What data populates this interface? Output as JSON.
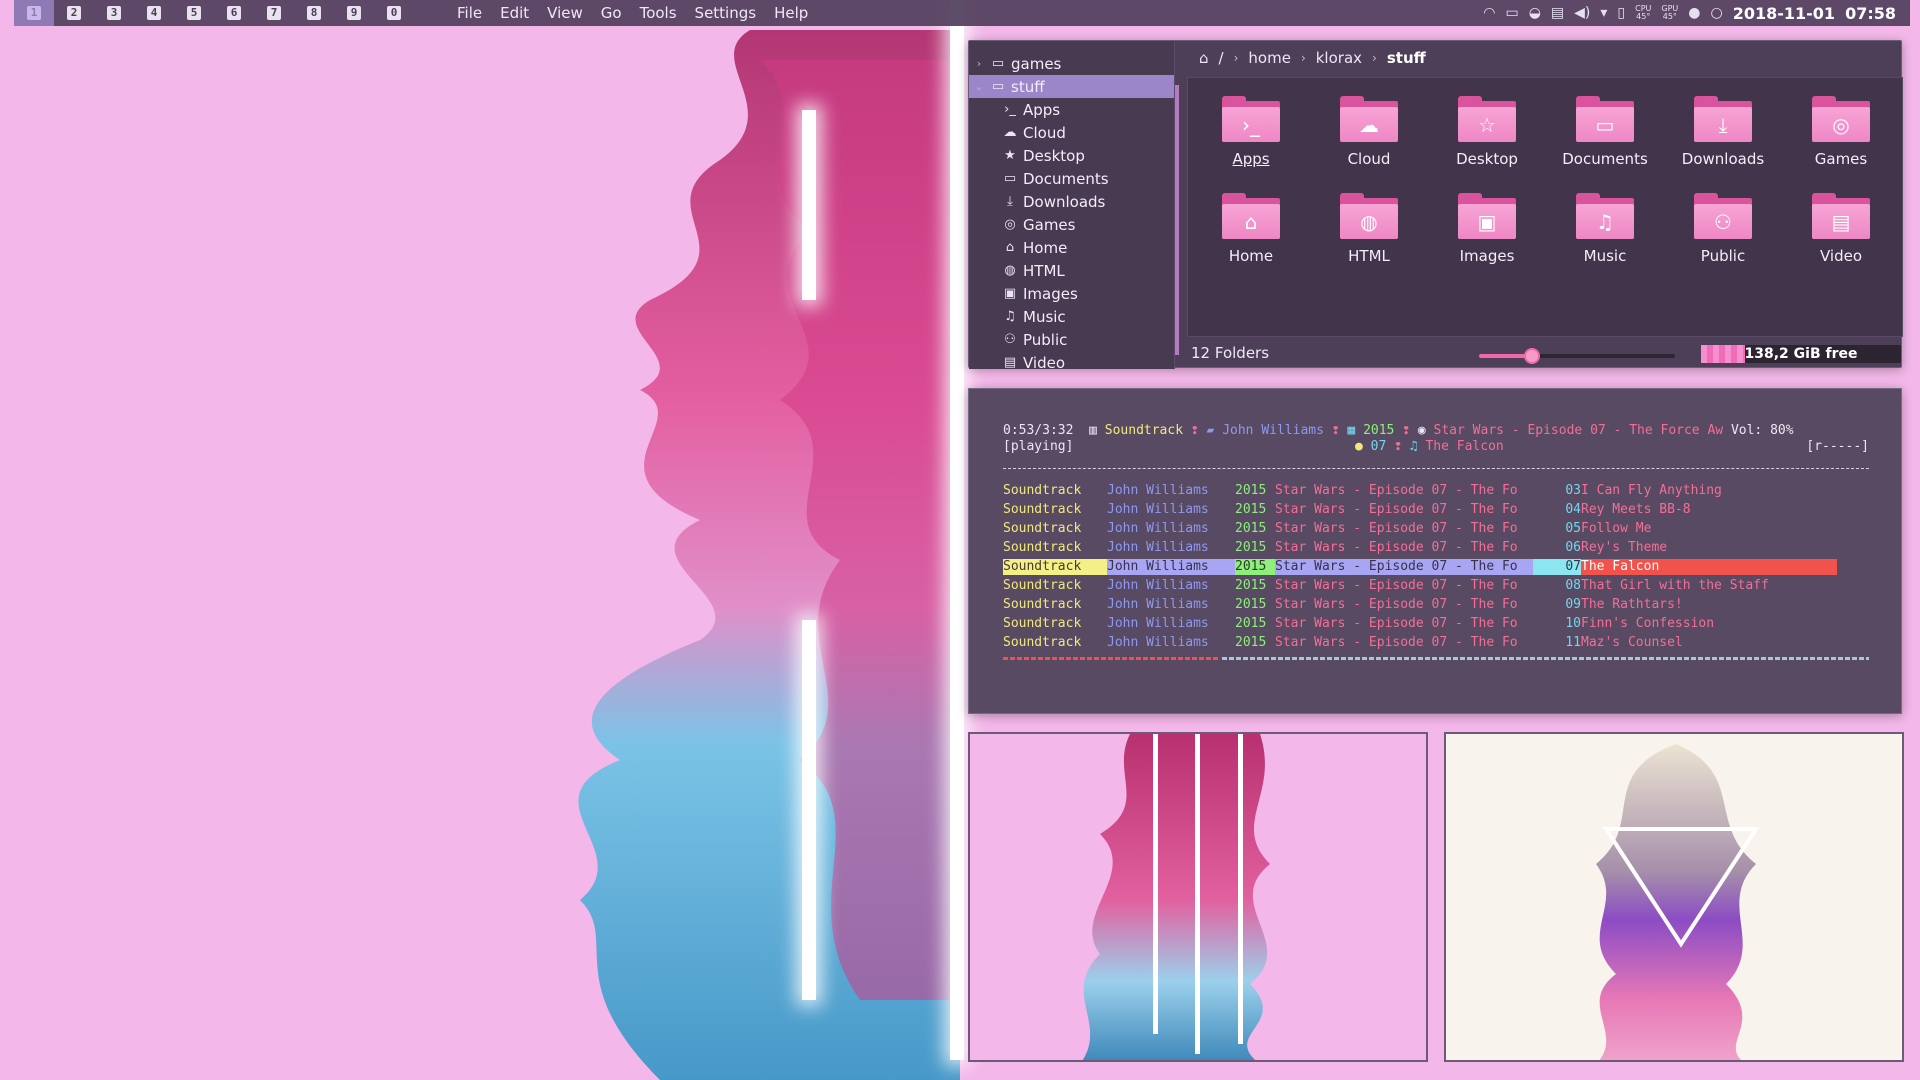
{
  "workspaces": [
    "1",
    "2",
    "3",
    "4",
    "5",
    "6",
    "7",
    "8",
    "9",
    "0"
  ],
  "menu": [
    "File",
    "Edit",
    "View",
    "Go",
    "Tools",
    "Settings",
    "Help"
  ],
  "tray": {
    "temp1_label": "CPU",
    "temp1": "45°",
    "temp2_label": "GPU",
    "temp2": "45°",
    "datetime": "2018-11-01",
    "time": "07:58"
  },
  "filemanager": {
    "tree": [
      {
        "label": "games",
        "icon": "folder-icon",
        "level": 0,
        "chevron": "›"
      },
      {
        "label": "stuff",
        "icon": "folder-icon",
        "level": 0,
        "chevron": "⌄",
        "selected": true
      },
      {
        "label": "Apps",
        "icon": "terminal-icon",
        "glyph": "›_",
        "level": 1
      },
      {
        "label": "Cloud",
        "icon": "cloud-icon",
        "glyph": "☁",
        "level": 1
      },
      {
        "label": "Desktop",
        "icon": "star-icon",
        "glyph": "★",
        "level": 1
      },
      {
        "label": "Documents",
        "icon": "document-icon",
        "glyph": "▭",
        "level": 1
      },
      {
        "label": "Downloads",
        "icon": "download-icon",
        "glyph": "⤓",
        "level": 1
      },
      {
        "label": "Games",
        "icon": "gamepad-icon",
        "glyph": "◎",
        "level": 1
      },
      {
        "label": "Home",
        "icon": "home-icon",
        "glyph": "⌂",
        "level": 1
      },
      {
        "label": "HTML",
        "icon": "globe-icon",
        "glyph": "◍",
        "level": 1
      },
      {
        "label": "Images",
        "icon": "image-icon",
        "glyph": "▣",
        "level": 1
      },
      {
        "label": "Music",
        "icon": "music-icon",
        "glyph": "♫",
        "level": 1
      },
      {
        "label": "Public",
        "icon": "users-icon",
        "glyph": "⚇",
        "level": 1
      },
      {
        "label": "Video",
        "icon": "film-icon",
        "glyph": "▤",
        "level": 1
      }
    ],
    "breadcrumb": [
      "/",
      "home",
      "klorax",
      "stuff"
    ],
    "folders": [
      {
        "name": "Apps",
        "icon": "terminal-icon",
        "glyph": "›_"
      },
      {
        "name": "Cloud",
        "icon": "cloud-icon",
        "glyph": "☁"
      },
      {
        "name": "Desktop",
        "icon": "star-icon",
        "glyph": "☆"
      },
      {
        "name": "Documents",
        "icon": "document-icon",
        "glyph": "▭"
      },
      {
        "name": "Downloads",
        "icon": "download-icon",
        "glyph": "⤓"
      },
      {
        "name": "Games",
        "icon": "gamepad-icon",
        "glyph": "◎"
      },
      {
        "name": "Home",
        "icon": "home-icon",
        "glyph": "⌂"
      },
      {
        "name": "HTML",
        "icon": "globe-icon",
        "glyph": "◍"
      },
      {
        "name": "Images",
        "icon": "image-icon",
        "glyph": "▣"
      },
      {
        "name": "Music",
        "icon": "music-icon",
        "glyph": "♫"
      },
      {
        "name": "Public",
        "icon": "users-icon",
        "glyph": "⚇"
      },
      {
        "name": "Video",
        "icon": "film-icon",
        "glyph": "▤"
      }
    ],
    "status": "12 Folders",
    "zoom_fraction": 0.27,
    "free_space": "138,2 GiB free",
    "used_fraction": 0.22
  },
  "player": {
    "time": "0:53/3:32",
    "genre": "Soundtrack",
    "artist": "John Williams",
    "year": "2015",
    "album": "Star Wars - Episode 07 - The Force Aw",
    "volume": "Vol: 80%",
    "state": "[playing]",
    "track_no": "07",
    "track_title": "The Falcon",
    "flags": "[r-----]",
    "progress_fraction": 0.25,
    "playlist": [
      {
        "genre": "Soundtrack",
        "artist": "John Williams",
        "year": "2015",
        "album": "Star Wars - Episode 07 - The Fo",
        "no": "03",
        "title": "I Can Fly Anything"
      },
      {
        "genre": "Soundtrack",
        "artist": "John Williams",
        "year": "2015",
        "album": "Star Wars - Episode 07 - The Fo",
        "no": "04",
        "title": "Rey Meets BB-8"
      },
      {
        "genre": "Soundtrack",
        "artist": "John Williams",
        "year": "2015",
        "album": "Star Wars - Episode 07 - The Fo",
        "no": "05",
        "title": "Follow Me"
      },
      {
        "genre": "Soundtrack",
        "artist": "John Williams",
        "year": "2015",
        "album": "Star Wars - Episode 07 - The Fo",
        "no": "06",
        "title": "Rey's Theme"
      },
      {
        "genre": "Soundtrack",
        "artist": "John Williams",
        "year": "2015",
        "album": "Star Wars - Episode 07 - The Fo",
        "no": "07",
        "title": "The Falcon",
        "current": true
      },
      {
        "genre": "Soundtrack",
        "artist": "John Williams",
        "year": "2015",
        "album": "Star Wars - Episode 07 - The Fo",
        "no": "08",
        "title": "That Girl with the Staff"
      },
      {
        "genre": "Soundtrack",
        "artist": "John Williams",
        "year": "2015",
        "album": "Star Wars - Episode 07 - The Fo",
        "no": "09",
        "title": "The Rathtars!"
      },
      {
        "genre": "Soundtrack",
        "artist": "John Williams",
        "year": "2015",
        "album": "Star Wars - Episode 07 - The Fo",
        "no": "10",
        "title": "Finn's Confession"
      },
      {
        "genre": "Soundtrack",
        "artist": "John Williams",
        "year": "2015",
        "album": "Star Wars - Episode 07 - The Fo",
        "no": "11",
        "title": "Maz's Counsel"
      }
    ]
  },
  "colors": {
    "accent": "#9b86c9",
    "folder": "#ee87c4",
    "bar_bg": "#503e5c",
    "terminal_bg": "#574a62",
    "current_row": "#f2524c"
  }
}
